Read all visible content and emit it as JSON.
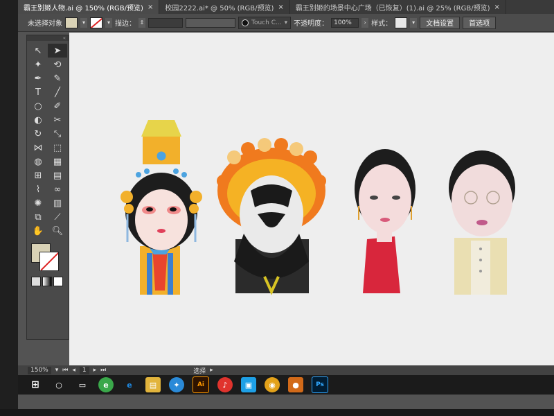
{
  "tabs": [
    {
      "label": "霸王别姬人物.ai @ 150% (RGB/预览)",
      "active": true
    },
    {
      "label": "校园2222.ai* @ 50% (RGB/预览)",
      "active": false
    },
    {
      "label": "霸王别姬的场景中心广场（已恢复）(1).ai @ 25% (RGB/预览)",
      "active": false
    }
  ],
  "control_bar": {
    "selection_label": "未选择对象",
    "stroke_label": "描边：",
    "brush_label": "Touch C...",
    "opacity_label": "不透明度：",
    "opacity_value": "100%",
    "style_label": "样式：",
    "doc_settings_button": "文档设置",
    "preferences_button": "首选项"
  },
  "status_bar": {
    "zoom": "150%",
    "page": "1",
    "mode": "选择"
  },
  "taskbar": {
    "ai_label": "Ai",
    "ps_label": "Ps"
  },
  "colors": {
    "fill": "#d9d2b6",
    "canvas": "#eeeeee",
    "accent_orange": "#f07a1e"
  }
}
